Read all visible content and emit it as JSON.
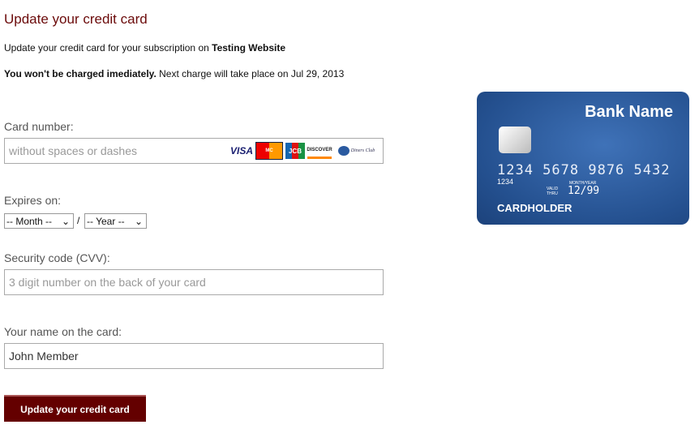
{
  "title": "Update your credit card",
  "intro": {
    "text": "Update your credit card for your subscription on ",
    "site_a": "Testing",
    "site_b": "Website"
  },
  "notice": {
    "bold": "You won't be charged imediately.",
    "text": " Next charge will take place on Jul 29, 2013"
  },
  "card_number": {
    "label": "Card number:",
    "placeholder": "without spaces or dashes",
    "logos": [
      "VISA",
      "MasterCard",
      "JCB",
      "DISCOVER",
      "Diners Club International"
    ]
  },
  "expires": {
    "label": "Expires on:",
    "month": "-- Month --",
    "separator": "/",
    "year": "-- Year --"
  },
  "cvv": {
    "label": "Security code (CVV):",
    "placeholder": "3 digit number on the back of your card"
  },
  "name": {
    "label": "Your name on the card:",
    "value": "John Member"
  },
  "submit": "Update your credit card",
  "card_image": {
    "bank": "Bank Name",
    "number": "1234 5678 9876 5432",
    "small": "1234",
    "valid": "VALID THRU",
    "month_year": "MONTH/YEAR",
    "expiry": "12/99",
    "holder": "CARDHOLDER"
  }
}
